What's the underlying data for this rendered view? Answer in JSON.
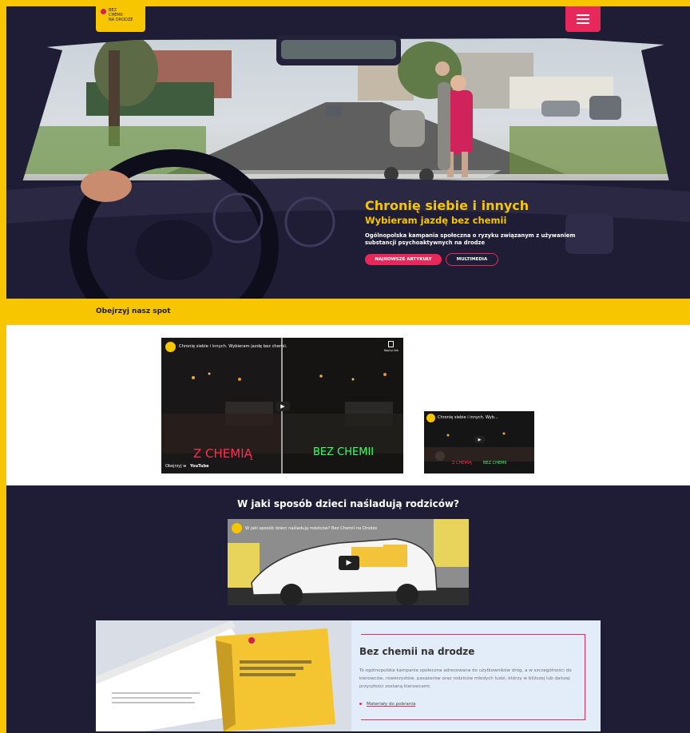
{
  "header": {
    "logo_text": "BEZ\nCHEMII\nNA DRODZE",
    "menu_icon": "hamburger-icon"
  },
  "hero": {
    "title": "Chronię siebie i innych",
    "subtitle": "Wybieram jazdę bez chemii",
    "description": "Ogólnopolska kampania społeczna o ryzyku związanym z używaniem substancji psychoaktywnych na drodze",
    "btn_primary": "Najnowsze artykuły",
    "btn_secondary": "Multimedia"
  },
  "spot": {
    "label": "Obejrzyj nasz spot"
  },
  "video_main": {
    "title": "Chronię siebie i innych. Wybieram jazdę bez chemii.",
    "copy_label": "Kopiuj link",
    "left_text": "Z CHEMIĄ",
    "right_text": "BEZ CHEMII",
    "watch_label": "Obejrzyj w",
    "youtube_label": "YouTube"
  },
  "video_small": {
    "title": "Chronię siebie i innych. Wyb...",
    "left_text": "Z CHEMIĄ",
    "right_text": "BEZ CHEMII"
  },
  "parents": {
    "title": "W jaki sposób dzieci naśladują rodziców?",
    "video_title": "W jaki sposób dzieci naśladują rodziców? Bez Chemii na Drodze"
  },
  "info_card": {
    "title": "Bez chemii na drodze",
    "text": "To ogólnopolska kampania społeczna adresowana do użytkowników dróg, a w szczególności do kierowców, rowerzystów, pasażerów oraz rodziców młodych ludzi, którzy w bliższej lub dalszej przyszłości zostaną kierowcami.",
    "link": "Materiały do pobrania"
  },
  "colors": {
    "brand_yellow": "#f7c600",
    "brand_pink": "#e6285a",
    "navy": "#1f1d35",
    "card_bg": "#e3edf9"
  }
}
